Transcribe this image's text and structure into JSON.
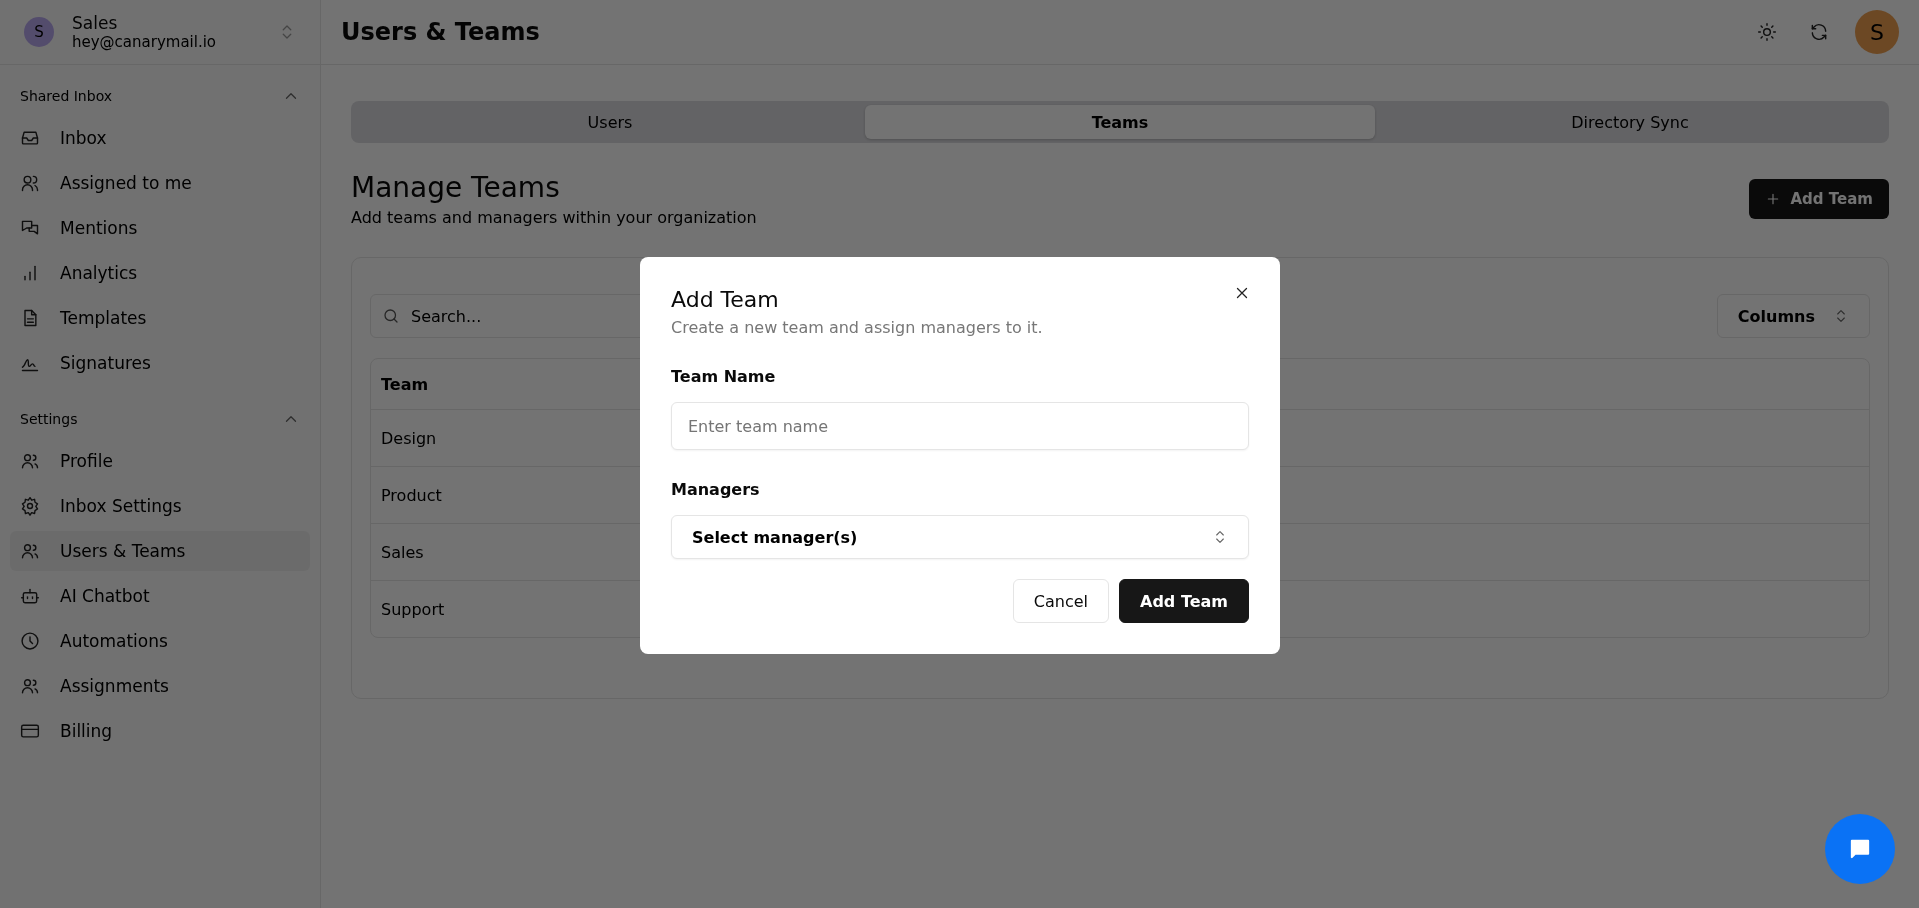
{
  "workspace": {
    "avatar_letter": "S",
    "name": "Sales",
    "email": "hey@canarymail.io"
  },
  "sidebar": {
    "sections": [
      {
        "title": "Shared Inbox",
        "expanded": true,
        "items": [
          {
            "label": "Inbox",
            "kind": "inbox",
            "selected": false
          },
          {
            "label": "Assigned to me",
            "kind": "user",
            "selected": false
          },
          {
            "label": "Mentions",
            "kind": "messages",
            "selected": false
          },
          {
            "label": "Analytics",
            "kind": "chart",
            "selected": false
          },
          {
            "label": "Templates",
            "kind": "document",
            "selected": false
          },
          {
            "label": "Signatures",
            "kind": "signature",
            "selected": false
          }
        ]
      },
      {
        "title": "Settings",
        "expanded": true,
        "items": [
          {
            "label": "Profile",
            "kind": "users",
            "selected": false
          },
          {
            "label": "Inbox Settings",
            "kind": "gear",
            "selected": false
          },
          {
            "label": "Users & Teams",
            "kind": "users",
            "selected": true
          },
          {
            "label": "AI Chatbot",
            "kind": "bot",
            "selected": false
          },
          {
            "label": "Automations",
            "kind": "clock",
            "selected": false
          },
          {
            "label": "Assignments",
            "kind": "users",
            "selected": false
          },
          {
            "label": "Billing",
            "kind": "card",
            "selected": false
          }
        ]
      }
    ]
  },
  "header": {
    "title": "Users & Teams",
    "avatar_letter": "S"
  },
  "tabs": [
    {
      "label": "Users",
      "selected": false
    },
    {
      "label": "Teams",
      "selected": true
    },
    {
      "label": "Directory Sync",
      "selected": false
    }
  ],
  "page": {
    "title": "Manage Teams",
    "subtitle": "Add teams and managers within your organization",
    "add_button": "Add Team"
  },
  "table": {
    "search_placeholder": "Search...",
    "columns_button": "Columns",
    "columns": [
      "Team"
    ],
    "rows": [
      [
        "Design"
      ],
      [
        "Product"
      ],
      [
        "Sales"
      ],
      [
        "Support"
      ]
    ]
  },
  "dialog": {
    "title": "Add Team",
    "description": "Create a new team and assign managers to it.",
    "fields": [
      {
        "kind": "text",
        "label": "Team Name",
        "placeholder": "Enter team name"
      },
      {
        "kind": "select",
        "label": "Managers",
        "value": "Select manager(s)"
      }
    ],
    "buttons": [
      {
        "kind": "secondary",
        "label": "Cancel"
      },
      {
        "kind": "primary",
        "label": "Add Team"
      }
    ]
  }
}
